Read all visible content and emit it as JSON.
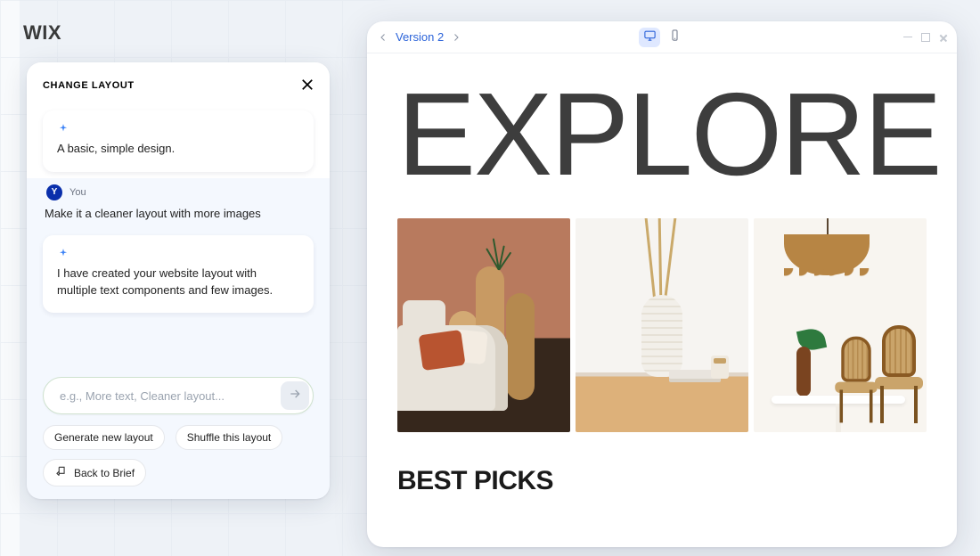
{
  "brand": "WIX",
  "chat": {
    "title": "CHANGE LAYOUT",
    "ai_intro": "A basic, simple design.",
    "user_label": "You",
    "user_initial": "Y",
    "user_msg": "Make it a cleaner layout with more images",
    "ai_reply": "I have created your website layout with multiple text components and few images.",
    "input_placeholder": "e.g., More text, Cleaner layout...",
    "chip_generate": "Generate new layout",
    "chip_shuffle": "Shuffle this layout",
    "back_label": "Back to Brief"
  },
  "preview": {
    "version_label": "Version 2",
    "hero": "EXPLORE",
    "section": "BEST PICKS"
  }
}
